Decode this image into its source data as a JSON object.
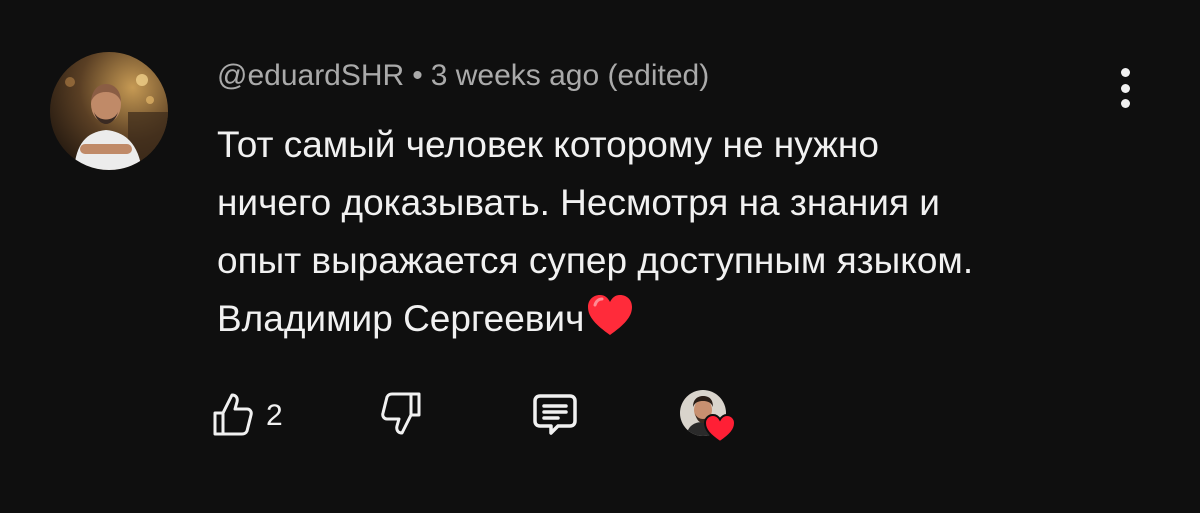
{
  "comment": {
    "author": "@eduardSHR",
    "separator": "•",
    "time": "3 weeks ago (edited)",
    "text_lines": [
      "Тот самый человек которому не нужно",
      "ничего доказывать. Несмотря на знания и",
      "опыт выражается супер доступным языком.",
      "Владимир Сергеевич"
    ],
    "emoji": "heart-emoji",
    "avatar": "author-avatar-photo"
  },
  "actions": {
    "like_icon": "thumb-up-icon",
    "like_count": "2",
    "dislike_icon": "thumb-down-icon",
    "reply_icon": "reply-comment-icon",
    "creator_heart": "creator-avatar-with-heart"
  },
  "menu": {
    "icon": "more-vertical-icon"
  },
  "colors": {
    "background": "#0f0f0f",
    "text_primary": "#f1f1f1",
    "text_secondary": "#aaaaaa",
    "heart_red": "#ff2b3a"
  }
}
